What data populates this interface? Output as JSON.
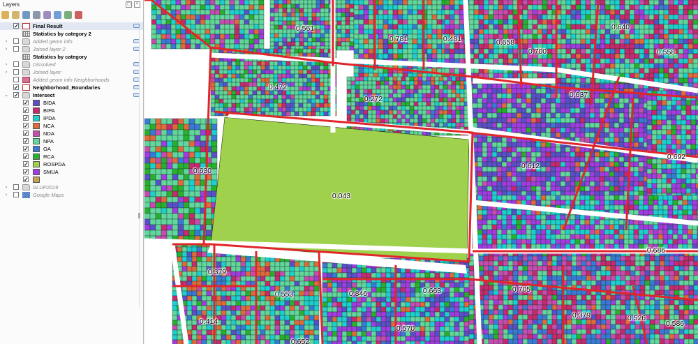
{
  "panel": {
    "title": "Layers"
  },
  "toolbar_icons": [
    "open-layer-styling-icon",
    "add-group-icon",
    "manage-visibility-icon",
    "filter-legend-icon",
    "filter-expression-icon",
    "expand-all-icon",
    "collapse-all-icon",
    "remove-layer-icon"
  ],
  "layers": [
    {
      "label": "Final Result",
      "icon": "polygon",
      "bold": true,
      "italic": false,
      "checked": true,
      "expand": "",
      "selected": true,
      "indicator": true
    },
    {
      "label": "Statistics by category 2",
      "icon": "table",
      "bold": true,
      "italic": false,
      "checked": null,
      "expand": "",
      "indicator": false
    },
    {
      "label": "Added geom info",
      "icon": "group",
      "bold": false,
      "italic": true,
      "checked": false,
      "expand": "›",
      "indicator": true
    },
    {
      "label": "Joined layer 2",
      "icon": "group",
      "bold": false,
      "italic": true,
      "checked": false,
      "expand": "›",
      "indicator": true
    },
    {
      "label": "Statistics by category",
      "icon": "table",
      "bold": true,
      "italic": false,
      "checked": null,
      "expand": "",
      "indicator": false
    },
    {
      "label": "Dissolved",
      "icon": "group",
      "bold": false,
      "italic": true,
      "checked": false,
      "expand": "›",
      "indicator": true
    },
    {
      "label": "Joined layer",
      "icon": "group",
      "bold": false,
      "italic": true,
      "checked": false,
      "expand": "›",
      "indicator": true
    },
    {
      "label": "Added geom info Neighborhoods",
      "icon": "pink",
      "bold": false,
      "italic": true,
      "checked": false,
      "expand": "",
      "indicator": true
    },
    {
      "label": "Neighborhood_Boundaries",
      "icon": "polygon",
      "bold": true,
      "italic": false,
      "checked": true,
      "expand": "",
      "indicator": true
    },
    {
      "label": "Intersect",
      "icon": "group",
      "bold": true,
      "italic": false,
      "checked": true,
      "expand": "⌄",
      "indicator": true
    }
  ],
  "categories": [
    {
      "label": "BIDA",
      "color": "#5b4fc9"
    },
    {
      "label": "BIPA",
      "color": "#c8286e"
    },
    {
      "label": "IPDA",
      "color": "#1ecfcf"
    },
    {
      "label": "NCA",
      "color": "#e06a3c"
    },
    {
      "label": "NDA",
      "color": "#c84cb0"
    },
    {
      "label": "NPA",
      "color": "#62d69c"
    },
    {
      "label": "OA",
      "color": "#3a7ad6"
    },
    {
      "label": "RCA",
      "color": "#29b02f"
    },
    {
      "label": "ROSPDA",
      "color": "#9fd14d"
    },
    {
      "label": "SMUA",
      "color": "#a23be0"
    },
    {
      "label": "",
      "color": "#c8a050"
    }
  ],
  "bottom_layers": [
    {
      "label": "SLUP2019",
      "icon": "group",
      "italic": true,
      "checked": false,
      "expand": "›"
    },
    {
      "label": "Google Maps",
      "icon": "google",
      "italic": true,
      "checked": false,
      "expand": "›"
    }
  ],
  "colors": {
    "boundary": "#e0262a",
    "npa": "#62d69c",
    "rospda": "#9fd14d",
    "smua": "#a23be0",
    "ipda": "#1ecfcf",
    "bipa": "#c8286e",
    "nda": "#c84cb0",
    "oa": "#3a7ad6",
    "bida": "#5b4fc9",
    "nca": "#e06a3c",
    "rca": "#29b02f"
  },
  "map_labels": [
    "0.561",
    "0.781",
    "0.481",
    "0.658",
    "0.640",
    "0.700",
    "0.558",
    "0.472",
    "0.272",
    "0.637",
    "0.612",
    "0.692",
    "0.630",
    "0.043",
    "0.686",
    "0.379",
    "0.846",
    "0.663",
    "0.553",
    "0.705",
    "0.414",
    "0.379",
    "0.570",
    "0.526",
    "0.586",
    "0.652"
  ]
}
